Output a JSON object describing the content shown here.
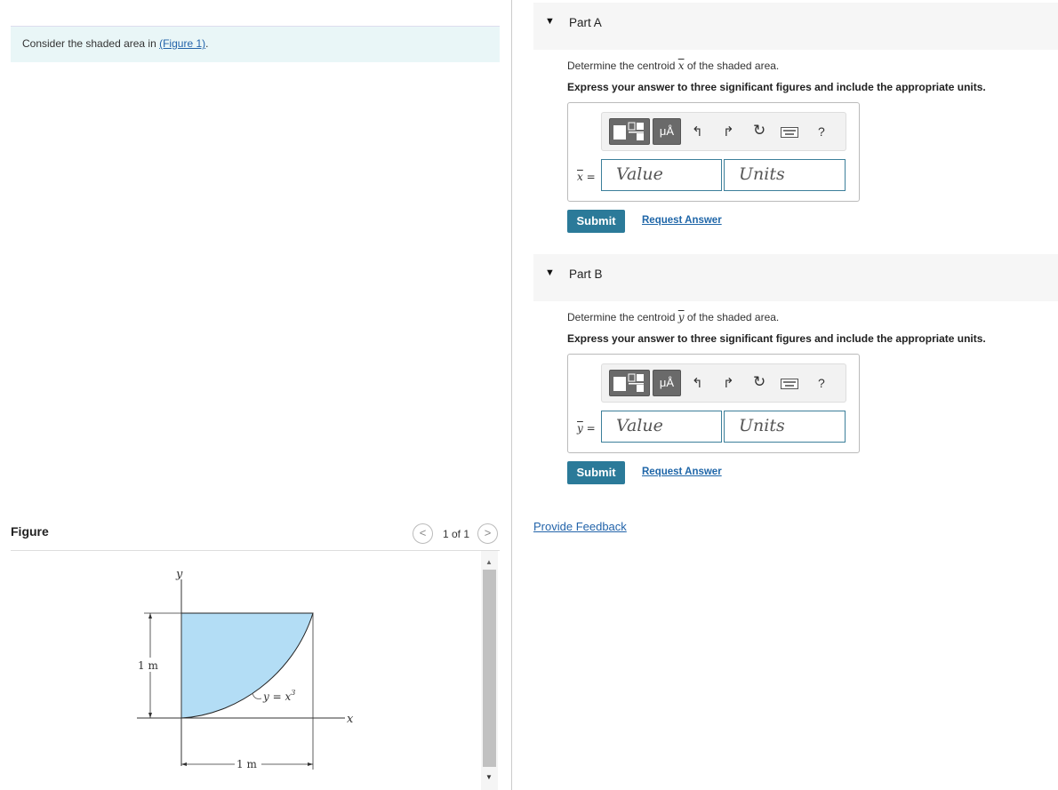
{
  "intro": {
    "prefix": "Consider the shaded area in ",
    "link": "(Figure 1)",
    "suffix": "."
  },
  "figure_panel": {
    "title": "Figure",
    "pager": "1 of 1",
    "prev": "<",
    "next": ">",
    "labels": {
      "y_axis": "y",
      "x_axis": "x",
      "height": "1 m",
      "width": "1 m",
      "curve_lhs": "y = x",
      "curve_exp": "3"
    }
  },
  "parts": [
    {
      "caret": "▼",
      "title": "Part A",
      "question_prefix": "Determine the centroid ",
      "question_var": "x",
      "question_suffix": " of the shaded area.",
      "instruction": "Express your answer to three significant figures and include the appropriate units.",
      "var_label": "x",
      "eq": " =",
      "value_placeholder": "Value",
      "units_placeholder": "Units",
      "submit": "Submit",
      "request": "Request Answer"
    },
    {
      "caret": "▼",
      "title": "Part B",
      "question_prefix": "Determine the centroid ",
      "question_var": "y",
      "question_suffix": " of the shaded area.",
      "instruction": "Express your answer to three significant figures and include the appropriate units.",
      "var_label": "y",
      "eq": " =",
      "value_placeholder": "Value",
      "units_placeholder": "Units",
      "submit": "Submit",
      "request": "Request Answer"
    }
  ],
  "toolbar": {
    "units_btn": "μÅ",
    "help": "?"
  },
  "feedback": "Provide Feedback",
  "colors": {
    "shade": "#b3ddf5",
    "accent": "#2b7a99",
    "link": "#2364aa"
  }
}
